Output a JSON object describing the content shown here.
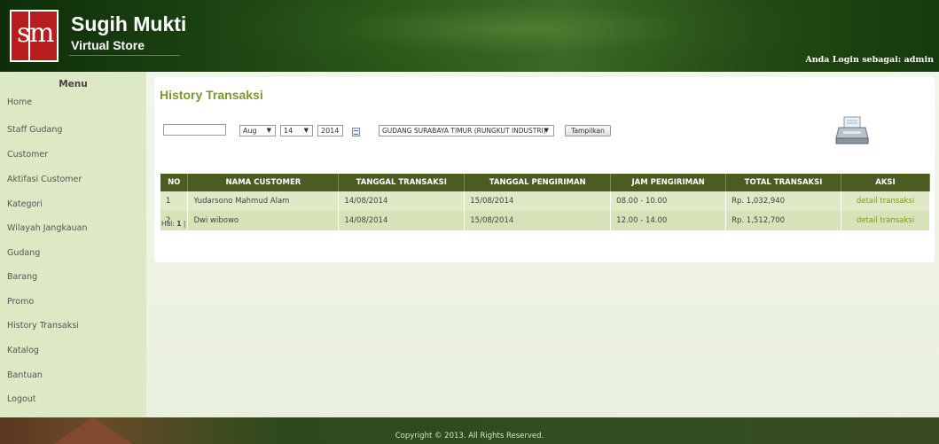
{
  "header": {
    "logo_s": "s",
    "logo_m": "m",
    "brand_name": "Sugih Mukti",
    "brand_sub": "Virtual Store",
    "login_text": "Anda Login sebagai: admin"
  },
  "sidebar": {
    "title": "Menu",
    "items": [
      {
        "label": "Home"
      },
      {
        "label": "Staff Gudang"
      },
      {
        "label": "Customer"
      },
      {
        "label": "Aktifasi Customer"
      },
      {
        "label": "Kategori"
      },
      {
        "label": "Wilayah Jangkauan"
      },
      {
        "label": "Gudang"
      },
      {
        "label": "Barang"
      },
      {
        "label": "Promo"
      },
      {
        "label": "History Transaksi"
      },
      {
        "label": "Katalog"
      },
      {
        "label": "Bantuan"
      },
      {
        "label": "Logout"
      }
    ]
  },
  "main": {
    "title": "History Transaksi",
    "filters": {
      "date_text_value": "",
      "month_selected": "Aug",
      "day_selected": "14",
      "year_value": "2014",
      "warehouse_selected": "GUDANG SURABAYA TIMUR (RUNGKUT INDUSTRI)",
      "show_button": "Tampilkan"
    },
    "table": {
      "headers": [
        "NO",
        "NAMA CUSTOMER",
        "TANGGAL TRANSAKSI",
        "TANGGAL PENGIRIMAN",
        "JAM PENGIRIMAN",
        "TOTAL TRANSAKSI",
        "AKSI"
      ],
      "rows": [
        {
          "no": "1",
          "customer": "Yudarsono Mahmud Alam",
          "tgl_transaksi": "14/08/2014",
          "tgl_pengiriman": "15/08/2014",
          "jam": "08.00 - 10.00",
          "total": "Rp. 1,032,940",
          "aksi": "detail transaksi"
        },
        {
          "no": "2",
          "customer": "Dwi wibowo",
          "tgl_transaksi": "14/08/2014",
          "tgl_pengiriman": "15/08/2014",
          "jam": "12.00 - 14.00",
          "total": "Rp. 1,512,700",
          "aksi": "detail transaksi"
        }
      ]
    },
    "pager": {
      "label": "Hal:",
      "current": "1",
      "sep": "|"
    }
  },
  "footer": {
    "copyright": "Copyright © 2013. All Rights Reserved."
  },
  "colors": {
    "accent": "#7a9a2a",
    "header_bg": "#4a5c22",
    "sidebar_bg": "#dde8c4",
    "logo_red": "#b81c1c"
  }
}
